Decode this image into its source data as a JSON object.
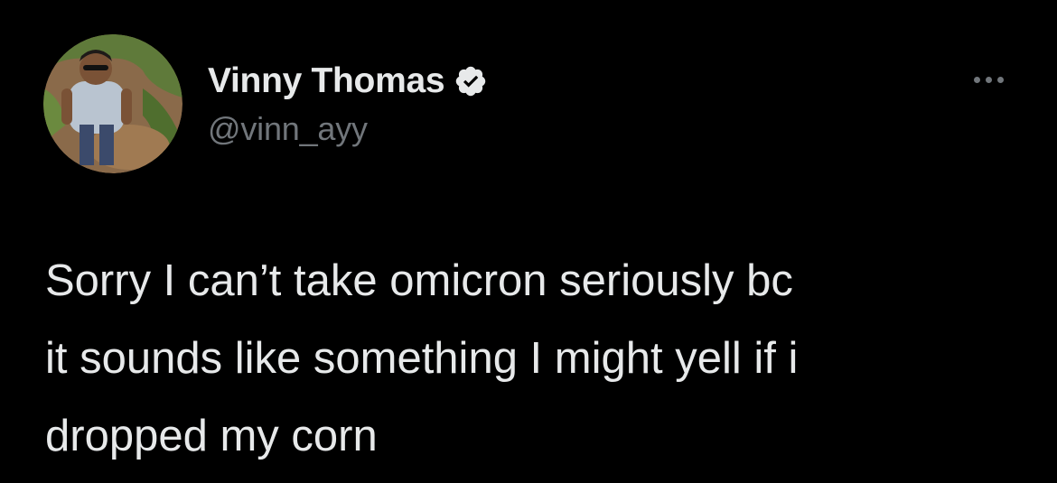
{
  "tweet": {
    "author": {
      "display_name": "Vinny Thomas",
      "handle": "@vinn_ayy",
      "verified": true,
      "avatar_icon": "profile-photo"
    },
    "more_icon": "ellipsis-icon",
    "text_lines": [
      "Sorry I can’t take omicron seriously bc",
      "it sounds like something I might yell if i",
      "dropped my corn"
    ]
  },
  "colors": {
    "background": "#000000",
    "primary_text": "#e7e9ea",
    "secondary_text": "#71767b",
    "verified_badge": "#e7e9ea"
  }
}
